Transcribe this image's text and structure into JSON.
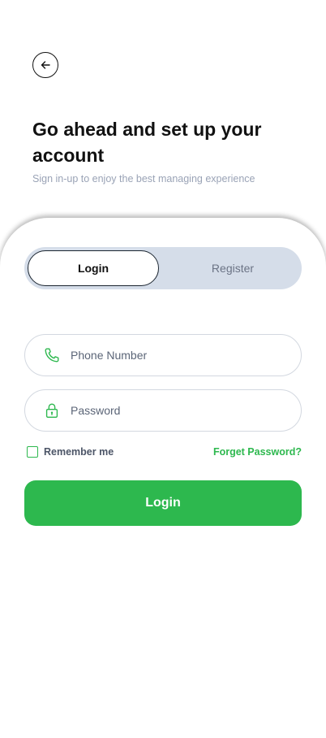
{
  "header": {
    "title": "Go ahead and set up your account",
    "subtitle": "Sign in-up to enjoy the best managing experience"
  },
  "tabs": {
    "login_label": "Login",
    "register_label": "Register",
    "active": "login"
  },
  "form": {
    "phone": {
      "value": "",
      "placeholder": "Phone Number",
      "icon": "phone-icon"
    },
    "password": {
      "value": "",
      "placeholder": "Password",
      "icon": "lock-icon"
    },
    "remember_label": "Remember me",
    "remember_checked": false,
    "forget_label": "Forget Password?",
    "submit_label": "Login"
  },
  "colors": {
    "accent": "#2db84e",
    "segment_bg": "#d5dde9",
    "subtitle": "#9aa3b6"
  }
}
